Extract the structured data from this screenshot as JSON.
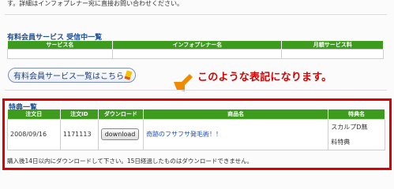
{
  "intro": {
    "text": "す。詳細はインフォプレナー宛に直接お問い合わせください。"
  },
  "subscriptions": {
    "title": "有料会員サービス  受信中一覧",
    "columns": [
      "サービス名",
      "インフォプレナー名",
      "月額サービス料"
    ],
    "list_button_label": "有料会員サービス一覧はこちら"
  },
  "callout": {
    "text": "このような表記になります。"
  },
  "benefits": {
    "title": "特典一覧",
    "columns": [
      "注文日",
      "注文ID",
      "ダウンロード",
      "商品名",
      "特典名"
    ],
    "rows": [
      {
        "date": "2008/09/16",
        "order_id": "1171113",
        "download_label": "download",
        "product": "奇跡のフサフサ発毛術！！",
        "benefit_line1": "スカルプD無",
        "benefit_line2": "料特典"
      }
    ],
    "footnote": "購入後14日以内にダウンロードして下さい。15日経過したものはダウンロードできません。"
  },
  "colors": {
    "header_green": "#3d9b1d",
    "title_blue": "#1a4f99",
    "highlight_red": "#e00000",
    "arrow_orange": "#f08a00"
  },
  "icons": [
    "pencil-icon",
    "arrow-icon"
  ]
}
